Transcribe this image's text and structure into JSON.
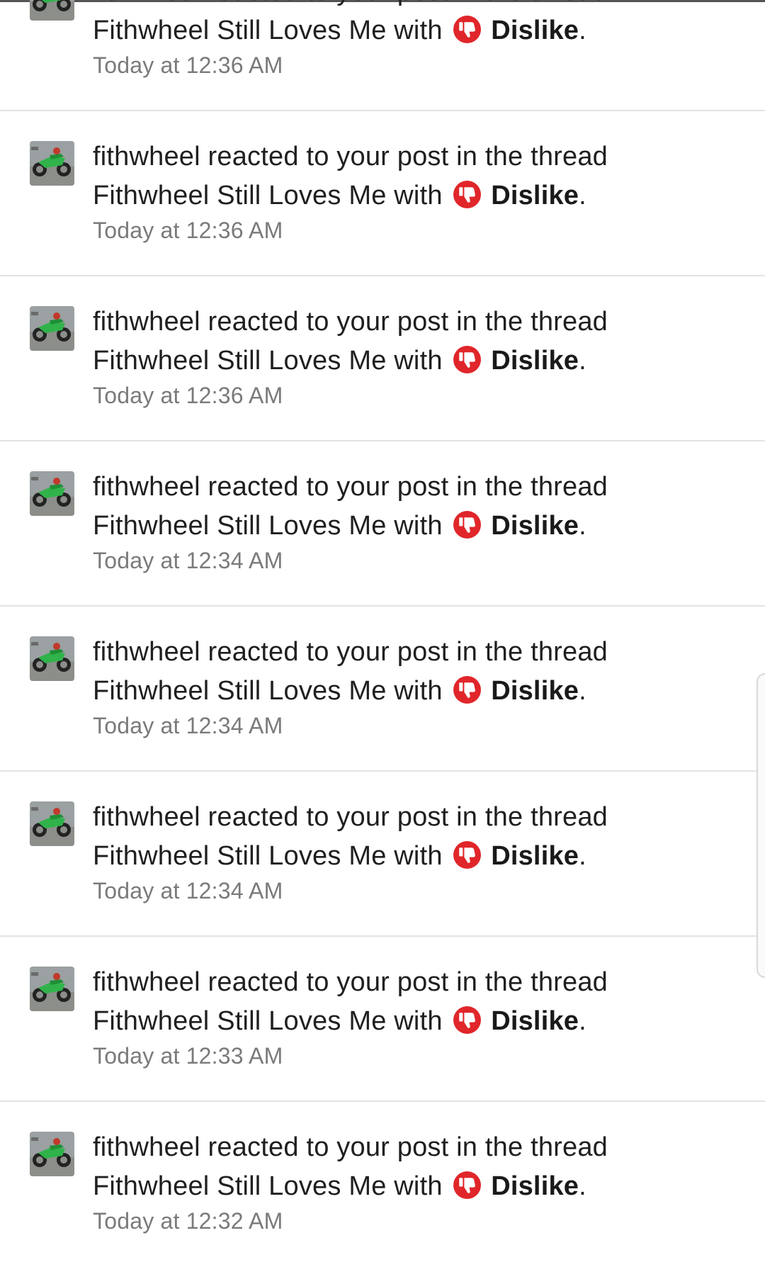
{
  "icons": {
    "avatar": "dirt-bike-avatar-icon",
    "reaction": "thumbs-down-icon"
  },
  "colors": {
    "reaction_icon": "#e0262a",
    "timestamp": "#7a7a7a",
    "divider": "#e3e3e3"
  },
  "notifications": [
    {
      "line1": "fithwheel reacted to your post in the thread",
      "line2_prefix": "Fithwheel Still Loves Me with",
      "reaction": "Dislike",
      "suffix": ".",
      "time": "Today at 12:36 AM"
    },
    {
      "line1": "fithwheel reacted to your post in the thread",
      "line2_prefix": "Fithwheel Still Loves Me with",
      "reaction": "Dislike",
      "suffix": ".",
      "time": "Today at 12:36 AM"
    },
    {
      "line1": "fithwheel reacted to your post in the thread",
      "line2_prefix": "Fithwheel Still Loves Me with",
      "reaction": "Dislike",
      "suffix": ".",
      "time": "Today at 12:36 AM"
    },
    {
      "line1": "fithwheel reacted to your post in the thread",
      "line2_prefix": "Fithwheel Still Loves Me with",
      "reaction": "Dislike",
      "suffix": ".",
      "time": "Today at 12:34 AM"
    },
    {
      "line1": "fithwheel reacted to your post in the thread",
      "line2_prefix": "Fithwheel Still Loves Me with",
      "reaction": "Dislike",
      "suffix": ".",
      "time": "Today at 12:34 AM"
    },
    {
      "line1": "fithwheel reacted to your post in the thread",
      "line2_prefix": "Fithwheel Still Loves Me with",
      "reaction": "Dislike",
      "suffix": ".",
      "time": "Today at 12:34 AM"
    },
    {
      "line1": "fithwheel reacted to your post in the thread",
      "line2_prefix": "Fithwheel Still Loves Me with",
      "reaction": "Dislike",
      "suffix": ".",
      "time": "Today at 12:33 AM"
    },
    {
      "line1": "fithwheel reacted to your post in the thread",
      "line2_prefix": "Fithwheel Still Loves Me with",
      "reaction": "Dislike",
      "suffix": ".",
      "time": "Today at 12:32 AM"
    }
  ]
}
